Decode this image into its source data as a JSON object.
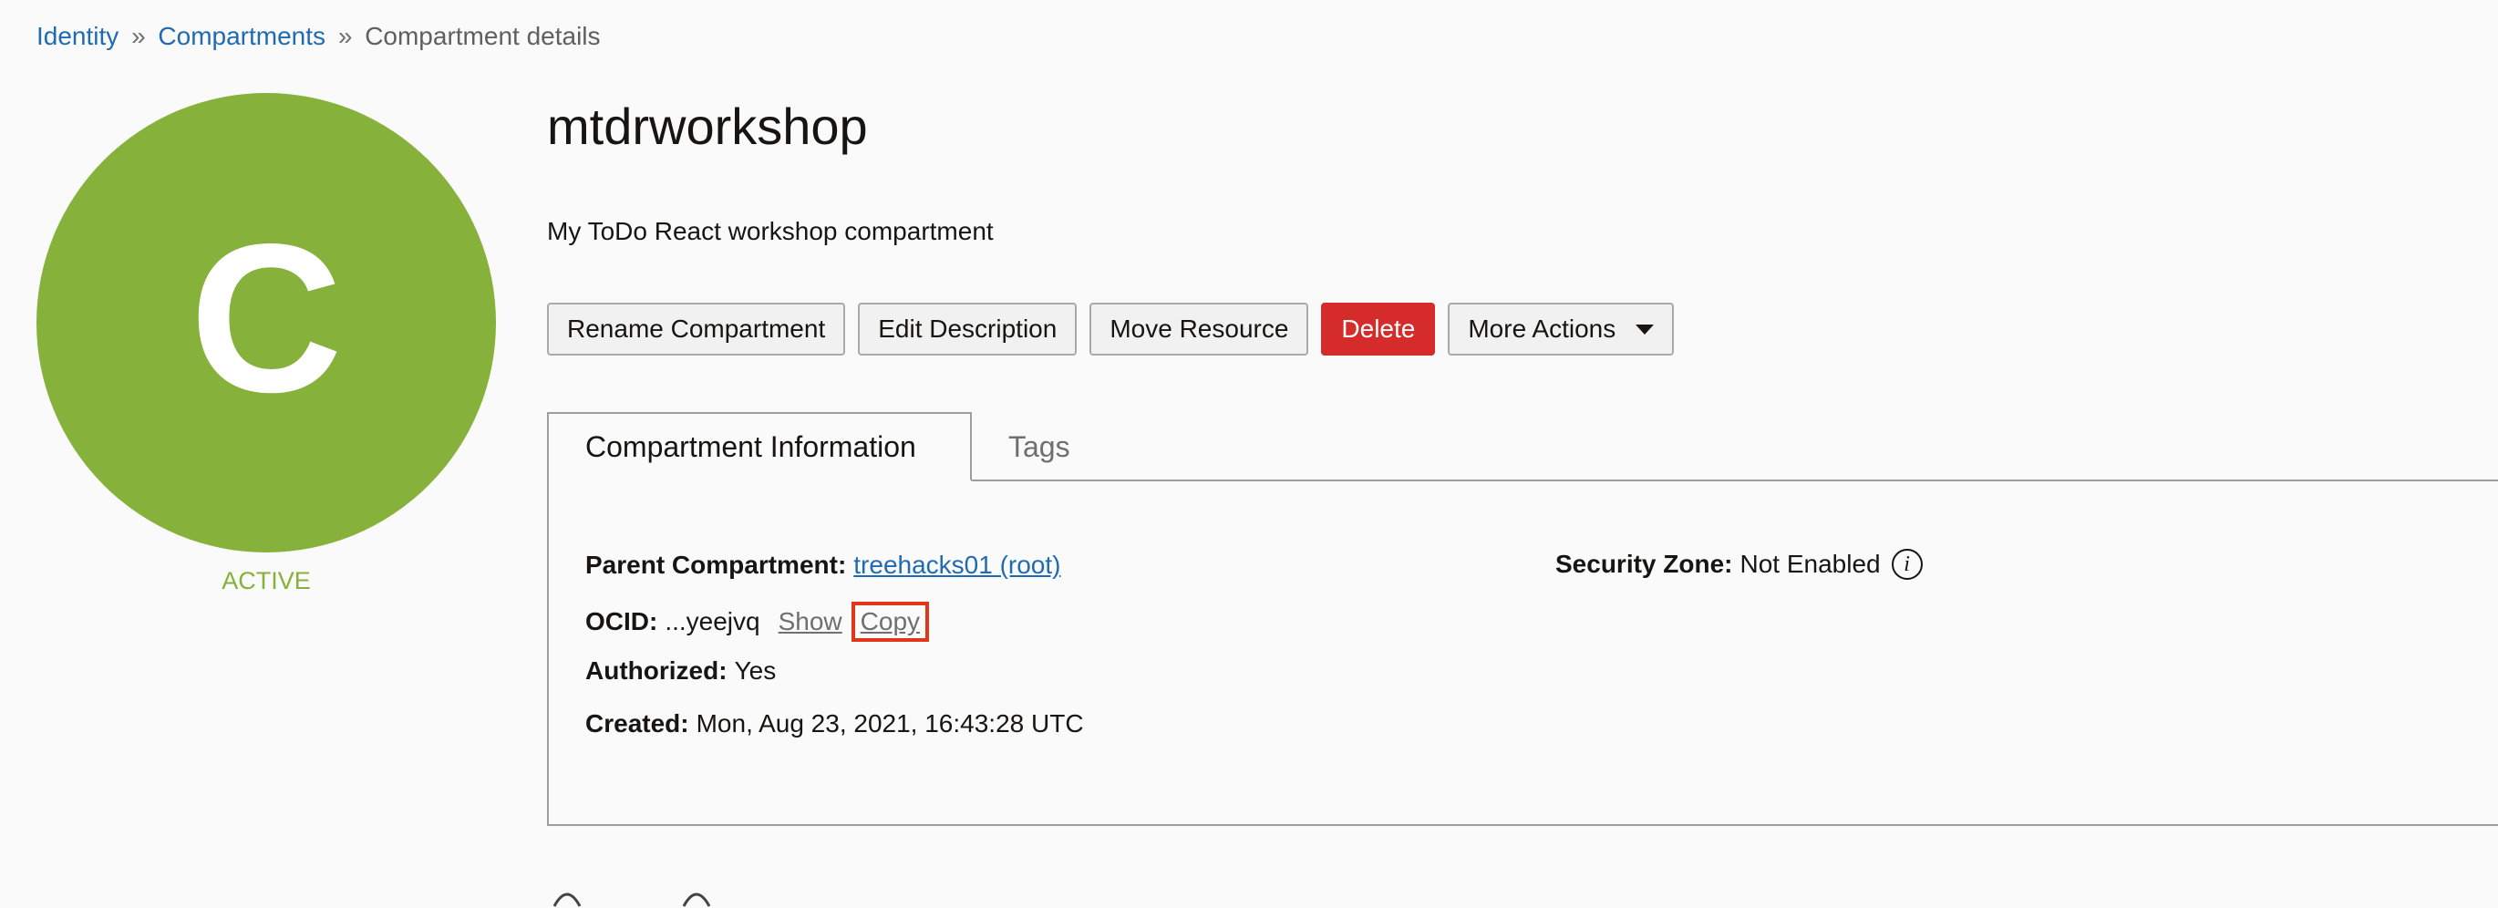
{
  "breadcrumb": {
    "items": [
      {
        "label": "Identity"
      },
      {
        "label": "Compartments"
      },
      {
        "label": "Compartment details"
      }
    ],
    "separator": "»"
  },
  "avatar": {
    "letter": "C",
    "status": "ACTIVE",
    "color": "#86b13b"
  },
  "header": {
    "title": "mtdrworkshop",
    "description": "My ToDo React workshop compartment"
  },
  "actions": {
    "rename": "Rename Compartment",
    "edit_description": "Edit Description",
    "move": "Move Resource",
    "delete": "Delete",
    "more": "More Actions"
  },
  "tabs": [
    {
      "label": "Compartment Information",
      "active": true
    },
    {
      "label": "Tags",
      "active": false
    }
  ],
  "info": {
    "parent": {
      "label": "Parent Compartment:",
      "value": "treehacks01 (root)"
    },
    "ocid": {
      "label": "OCID:",
      "value": "...yeejvq",
      "show": "Show",
      "copy": "Copy"
    },
    "authorized": {
      "label": "Authorized:",
      "value": "Yes"
    },
    "created": {
      "label": "Created:",
      "value": "Mon, Aug 23, 2021, 16:43:28 UTC"
    },
    "security_zone": {
      "label": "Security Zone:",
      "value": "Not Enabled",
      "icon": "info-icon"
    }
  },
  "colors": {
    "accent": "#1f6bb3",
    "danger": "#d52b2b",
    "highlight": "#e2361b"
  }
}
